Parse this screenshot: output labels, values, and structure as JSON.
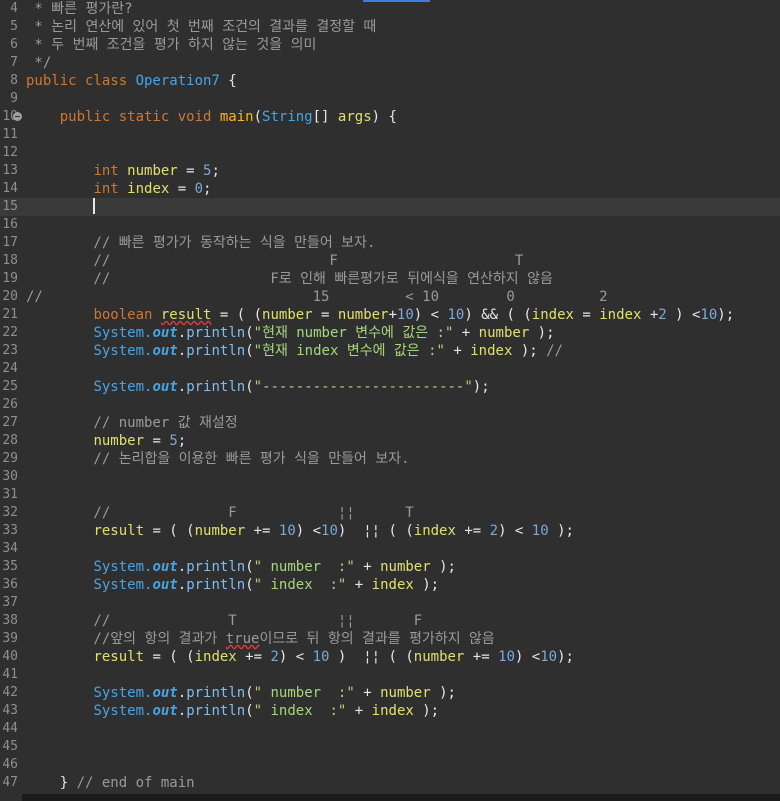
{
  "editor": {
    "lines": [
      {
        "n": "4",
        "parts": [
          [
            "t-com",
            " * 빠른 평가란?"
          ]
        ]
      },
      {
        "n": "5",
        "parts": [
          [
            "t-com",
            " * 논리 연산에 있어 첫 번째 조건의 결과를 결정할 때"
          ]
        ]
      },
      {
        "n": "6",
        "parts": [
          [
            "t-com",
            " * 두 번째 조건을 평가 하지 않는 것을 의미"
          ]
        ]
      },
      {
        "n": "7",
        "parts": [
          [
            "t-com",
            " */"
          ]
        ]
      },
      {
        "n": "8",
        "parts": [
          [
            "t-kw",
            "public class "
          ],
          [
            "t-cls",
            "Operation7"
          ],
          [
            "t-op",
            " {"
          ]
        ]
      },
      {
        "n": "9",
        "parts": []
      },
      {
        "n": "10",
        "fold": true,
        "parts": [
          [
            "t-op",
            "    "
          ],
          [
            "t-kw",
            "public static void "
          ],
          [
            "t-mth",
            "main"
          ],
          [
            "t-op",
            "("
          ],
          [
            "t-cls",
            "String"
          ],
          [
            "t-op",
            "[] "
          ],
          [
            "t-var",
            "args"
          ],
          [
            "t-op",
            ") {"
          ]
        ]
      },
      {
        "n": "11",
        "parts": []
      },
      {
        "n": "12",
        "parts": []
      },
      {
        "n": "13",
        "parts": [
          [
            "t-op",
            "        "
          ],
          [
            "t-kw",
            "int "
          ],
          [
            "t-var",
            "number"
          ],
          [
            "t-op",
            " = "
          ],
          [
            "t-num",
            "5"
          ],
          [
            "t-op",
            ";"
          ]
        ]
      },
      {
        "n": "14",
        "parts": [
          [
            "t-op",
            "        "
          ],
          [
            "t-kw",
            "int "
          ],
          [
            "t-var",
            "index"
          ],
          [
            "t-op",
            " = "
          ],
          [
            "t-num",
            "0"
          ],
          [
            "t-op",
            ";"
          ]
        ]
      },
      {
        "n": "15",
        "current": true,
        "caret": true,
        "parts": [
          [
            "t-op",
            "        "
          ]
        ]
      },
      {
        "n": "16",
        "parts": []
      },
      {
        "n": "17",
        "parts": [
          [
            "t-com",
            "        // 빠른 평가가 동작하는 식을 만들어 보자."
          ]
        ]
      },
      {
        "n": "18",
        "parts": [
          [
            "t-com",
            "        //                          F                     T"
          ]
        ]
      },
      {
        "n": "19",
        "parts": [
          [
            "t-com",
            "        //                   F로 인해 빠른평가로 뒤에식을 연산하지 않음"
          ]
        ]
      },
      {
        "n": "20",
        "parts": [
          [
            "t-com",
            "//                                15         < 10        0          2"
          ]
        ]
      },
      {
        "n": "21",
        "parts": [
          [
            "t-op",
            "        "
          ],
          [
            "t-kw",
            "boolean "
          ],
          [
            "t-err",
            "result"
          ],
          [
            "t-op",
            " = ( ("
          ],
          [
            "t-var",
            "number"
          ],
          [
            "t-op",
            " = "
          ],
          [
            "t-var",
            "number"
          ],
          [
            "t-op",
            "+"
          ],
          [
            "t-num",
            "10"
          ],
          [
            "t-op",
            ") < "
          ],
          [
            "t-num",
            "10"
          ],
          [
            "t-op",
            ") && ( ("
          ],
          [
            "t-var",
            "index"
          ],
          [
            "t-op",
            " = "
          ],
          [
            "t-var",
            "index"
          ],
          [
            "t-op",
            " +"
          ],
          [
            "t-num",
            "2"
          ],
          [
            "t-op",
            " ) <"
          ],
          [
            "t-num",
            "10"
          ],
          [
            "t-op",
            ");"
          ]
        ]
      },
      {
        "n": "22",
        "parts": [
          [
            "t-op",
            "        "
          ],
          [
            "t-sys",
            "System."
          ],
          [
            "t-out",
            "out"
          ],
          [
            "t-op",
            "."
          ],
          [
            "t-pl",
            "println"
          ],
          [
            "t-op",
            "("
          ],
          [
            "t-str",
            "\"현재 number 변수에 값은 :\""
          ],
          [
            "t-op",
            " + "
          ],
          [
            "t-var",
            "number"
          ],
          [
            "t-op",
            " );"
          ]
        ]
      },
      {
        "n": "23",
        "parts": [
          [
            "t-op",
            "        "
          ],
          [
            "t-sys",
            "System."
          ],
          [
            "t-out",
            "out"
          ],
          [
            "t-op",
            "."
          ],
          [
            "t-pl",
            "println"
          ],
          [
            "t-op",
            "("
          ],
          [
            "t-str",
            "\"현재 index 변수에 값은 :\""
          ],
          [
            "t-op",
            " + "
          ],
          [
            "t-var",
            "index"
          ],
          [
            "t-op",
            " ); "
          ],
          [
            "t-com",
            "//"
          ]
        ]
      },
      {
        "n": "24",
        "parts": []
      },
      {
        "n": "25",
        "parts": [
          [
            "t-op",
            "        "
          ],
          [
            "t-sys",
            "System."
          ],
          [
            "t-out",
            "out"
          ],
          [
            "t-op",
            "."
          ],
          [
            "t-pl",
            "println"
          ],
          [
            "t-op",
            "("
          ],
          [
            "t-str",
            "\"------------------------\""
          ],
          [
            "t-op",
            ");"
          ]
        ]
      },
      {
        "n": "26",
        "parts": []
      },
      {
        "n": "27",
        "parts": [
          [
            "t-com",
            "        // number 값 재설정"
          ]
        ]
      },
      {
        "n": "28",
        "parts": [
          [
            "t-op",
            "        "
          ],
          [
            "t-var",
            "number"
          ],
          [
            "t-op",
            " = "
          ],
          [
            "t-num",
            "5"
          ],
          [
            "t-op",
            ";"
          ]
        ]
      },
      {
        "n": "29",
        "parts": [
          [
            "t-com",
            "        // 논리합을 이용한 빠른 평가 식을 만들어 보자."
          ]
        ]
      },
      {
        "n": "30",
        "parts": []
      },
      {
        "n": "31",
        "parts": []
      },
      {
        "n": "32",
        "parts": [
          [
            "t-com",
            "        //              F            ¦¦      T"
          ]
        ]
      },
      {
        "n": "33",
        "parts": [
          [
            "t-op",
            "        "
          ],
          [
            "t-var",
            "result"
          ],
          [
            "t-op",
            " = ( ("
          ],
          [
            "t-var",
            "number"
          ],
          [
            "t-op",
            " += "
          ],
          [
            "t-num",
            "10"
          ],
          [
            "t-op",
            ") <"
          ],
          [
            "t-num",
            "10"
          ],
          [
            "t-op",
            ")  ¦¦ ( ("
          ],
          [
            "t-var",
            "index"
          ],
          [
            "t-op",
            " += "
          ],
          [
            "t-num",
            "2"
          ],
          [
            "t-op",
            ") < "
          ],
          [
            "t-num",
            "10"
          ],
          [
            "t-op",
            " );"
          ]
        ]
      },
      {
        "n": "34",
        "parts": []
      },
      {
        "n": "35",
        "parts": [
          [
            "t-op",
            "        "
          ],
          [
            "t-sys",
            "System."
          ],
          [
            "t-out",
            "out"
          ],
          [
            "t-op",
            "."
          ],
          [
            "t-pl",
            "println"
          ],
          [
            "t-op",
            "("
          ],
          [
            "t-str",
            "\" number  :\""
          ],
          [
            "t-op",
            " + "
          ],
          [
            "t-var",
            "number"
          ],
          [
            "t-op",
            " );"
          ]
        ]
      },
      {
        "n": "36",
        "parts": [
          [
            "t-op",
            "        "
          ],
          [
            "t-sys",
            "System."
          ],
          [
            "t-out",
            "out"
          ],
          [
            "t-op",
            "."
          ],
          [
            "t-pl",
            "println"
          ],
          [
            "t-op",
            "("
          ],
          [
            "t-str",
            "\" index  :\""
          ],
          [
            "t-op",
            " + "
          ],
          [
            "t-var",
            "index"
          ],
          [
            "t-op",
            " );"
          ]
        ]
      },
      {
        "n": "37",
        "parts": []
      },
      {
        "n": "38",
        "parts": [
          [
            "t-com",
            "        //              T            ¦¦       F"
          ]
        ]
      },
      {
        "n": "39",
        "parts": [
          [
            "t-com",
            "        //앞의 항의 결과가 "
          ],
          [
            "t-comerr",
            "true"
          ],
          [
            "t-com",
            "이므로 뒤 항의 결과를 평가하지 않음"
          ]
        ]
      },
      {
        "n": "40",
        "parts": [
          [
            "t-op",
            "        "
          ],
          [
            "t-var",
            "result"
          ],
          [
            "t-op",
            " = ( ("
          ],
          [
            "t-var",
            "index"
          ],
          [
            "t-op",
            " += "
          ],
          [
            "t-num",
            "2"
          ],
          [
            "t-op",
            ") < "
          ],
          [
            "t-num",
            "10"
          ],
          [
            "t-op",
            " )  ¦¦ ( ("
          ],
          [
            "t-var",
            "number"
          ],
          [
            "t-op",
            " += "
          ],
          [
            "t-num",
            "10"
          ],
          [
            "t-op",
            ") <"
          ],
          [
            "t-num",
            "10"
          ],
          [
            "t-op",
            ");"
          ]
        ]
      },
      {
        "n": "41",
        "parts": []
      },
      {
        "n": "42",
        "parts": [
          [
            "t-op",
            "        "
          ],
          [
            "t-sys",
            "System."
          ],
          [
            "t-out",
            "out"
          ],
          [
            "t-op",
            "."
          ],
          [
            "t-pl",
            "println"
          ],
          [
            "t-op",
            "("
          ],
          [
            "t-str",
            "\" number  :\""
          ],
          [
            "t-op",
            " + "
          ],
          [
            "t-var",
            "number"
          ],
          [
            "t-op",
            " );"
          ]
        ]
      },
      {
        "n": "43",
        "parts": [
          [
            "t-op",
            "        "
          ],
          [
            "t-sys",
            "System."
          ],
          [
            "t-out",
            "out"
          ],
          [
            "t-op",
            "."
          ],
          [
            "t-pl",
            "println"
          ],
          [
            "t-op",
            "("
          ],
          [
            "t-str",
            "\" index  :\""
          ],
          [
            "t-op",
            " + "
          ],
          [
            "t-var",
            "index"
          ],
          [
            "t-op",
            " );"
          ]
        ]
      },
      {
        "n": "44",
        "parts": []
      },
      {
        "n": "45",
        "parts": []
      },
      {
        "n": "46",
        "parts": []
      },
      {
        "n": "47",
        "parts": [
          [
            "t-op",
            "    } "
          ],
          [
            "t-com",
            "// end of main"
          ]
        ]
      }
    ]
  }
}
